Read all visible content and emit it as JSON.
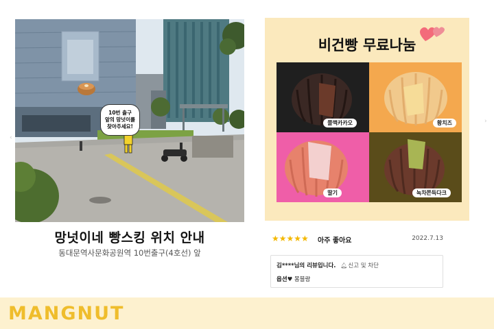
{
  "location": {
    "title": "망넛이네 빵스킹 위치 안내",
    "subtitle": "동대문역사문화공원역 10번출구(4호선) 앞",
    "bubble_lines": [
      "10번 출구",
      "앞의 망넛이를",
      "찾아주세요!"
    ]
  },
  "promo": {
    "title": "비건빵 무료나눔",
    "breads": [
      {
        "label": "쫄깩카카오",
        "bg": "#1f1f1f",
        "dough": "#3a2824",
        "filling": "#6b3a2a"
      },
      {
        "label": "황치즈",
        "bg": "#f4a84e",
        "dough": "#f1c98c",
        "filling": "#f6dc98"
      },
      {
        "label": "딸기",
        "bg": "#ef5ea8",
        "dough": "#e7826c",
        "filling": "#f3d0cf"
      },
      {
        "label": "녹차쫀득다크",
        "bg": "#5a4c1a",
        "dough": "#6b3a2c",
        "filling": "#a8b554"
      }
    ]
  },
  "review": {
    "stars": "★★★★★",
    "rating_text": "아주 좋아요",
    "date": "2022.7.13",
    "reviewer": "김****님의 리뷰입니다.",
    "report": "신고 및 차단",
    "option_label": "옵션♥",
    "option_value": "몽블랑"
  },
  "footer": {
    "brand": "MANGNUT"
  },
  "colors": {
    "accent": "#efbd2c",
    "footer_bg": "#fdf1cf",
    "promo_bg": "#fbe9bd",
    "star": "#f4b800"
  }
}
